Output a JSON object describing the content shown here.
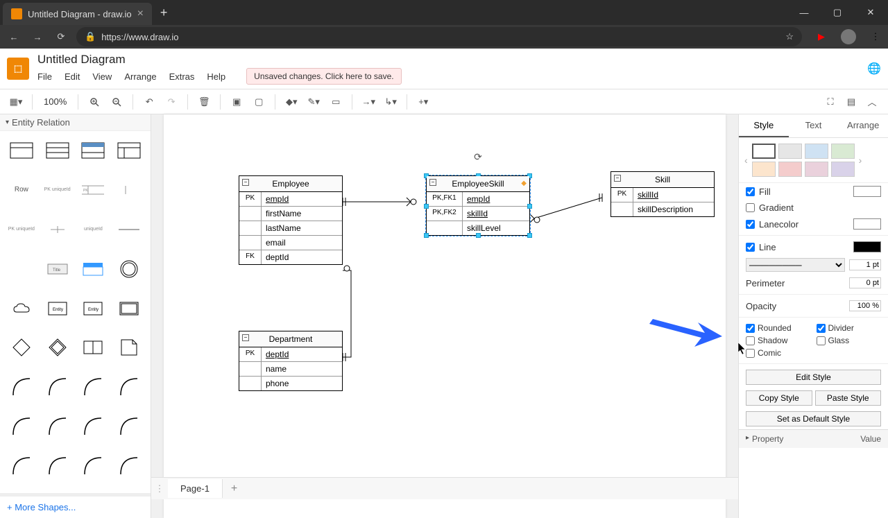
{
  "browser": {
    "tab_title": "Untitled Diagram - draw.io",
    "url": "https://www.draw.io"
  },
  "header": {
    "doc_title": "Untitled Diagram",
    "menus": [
      "File",
      "Edit",
      "View",
      "Arrange",
      "Extras",
      "Help"
    ],
    "unsaved_msg": "Unsaved changes. Click here to save."
  },
  "toolbar": {
    "zoom": "100%"
  },
  "sidebar": {
    "section_title": "Entity Relation",
    "more_shapes": "More Shapes..."
  },
  "canvas": {
    "tables": {
      "employee": {
        "title": "Employee",
        "rows": [
          {
            "key": "PK",
            "field": "empId",
            "underline": true
          },
          {
            "key": "",
            "field": "firstName"
          },
          {
            "key": "",
            "field": "lastName"
          },
          {
            "key": "",
            "field": "email"
          },
          {
            "key": "FK",
            "field": "deptId"
          }
        ]
      },
      "employeeskill": {
        "title": "EmployeeSkill",
        "rows": [
          {
            "key": "PK,FK1",
            "field": "empId",
            "underline": true
          },
          {
            "key": "PK,FK2",
            "field": "skillId",
            "underline": true
          },
          {
            "key": "",
            "field": "skillLevel"
          }
        ]
      },
      "skill": {
        "title": "Skill",
        "rows": [
          {
            "key": "PK",
            "field": "skillId",
            "underline": true
          },
          {
            "key": "",
            "field": "skillDescription"
          }
        ]
      },
      "department": {
        "title": "Department",
        "rows": [
          {
            "key": "PK",
            "field": "deptId",
            "underline": true
          },
          {
            "key": "",
            "field": "name"
          },
          {
            "key": "",
            "field": "phone"
          }
        ]
      }
    }
  },
  "panel": {
    "tabs": [
      "Style",
      "Text",
      "Arrange"
    ],
    "active_tab": 0,
    "swatches": [
      "#ffffff",
      "#e6e6e6",
      "#cfe2f3",
      "#d9ead3",
      "#fce5cd",
      "#f4cccc",
      "#ead1dc",
      "#d9d2e9"
    ],
    "fill": {
      "label": "Fill",
      "checked": true,
      "color": "#ffffff"
    },
    "gradient": {
      "label": "Gradient",
      "checked": false
    },
    "lanecolor": {
      "label": "Lanecolor",
      "checked": true,
      "color": "#ffffff"
    },
    "line": {
      "label": "Line",
      "checked": true,
      "color": "#000000",
      "width": "1 pt"
    },
    "perimeter": {
      "label": "Perimeter",
      "value": "0 pt"
    },
    "opacity": {
      "label": "Opacity",
      "value": "100 %"
    },
    "checks": {
      "rounded": {
        "label": "Rounded",
        "checked": true
      },
      "divider": {
        "label": "Divider",
        "checked": true
      },
      "shadow": {
        "label": "Shadow",
        "checked": false
      },
      "glass": {
        "label": "Glass",
        "checked": false
      },
      "comic": {
        "label": "Comic",
        "checked": false
      }
    },
    "buttons": {
      "edit_style": "Edit Style",
      "copy_style": "Copy Style",
      "paste_style": "Paste Style",
      "default_style": "Set as Default Style"
    },
    "prop_header": {
      "prop": "Property",
      "val": "Value"
    }
  },
  "pages": {
    "page1": "Page-1"
  }
}
